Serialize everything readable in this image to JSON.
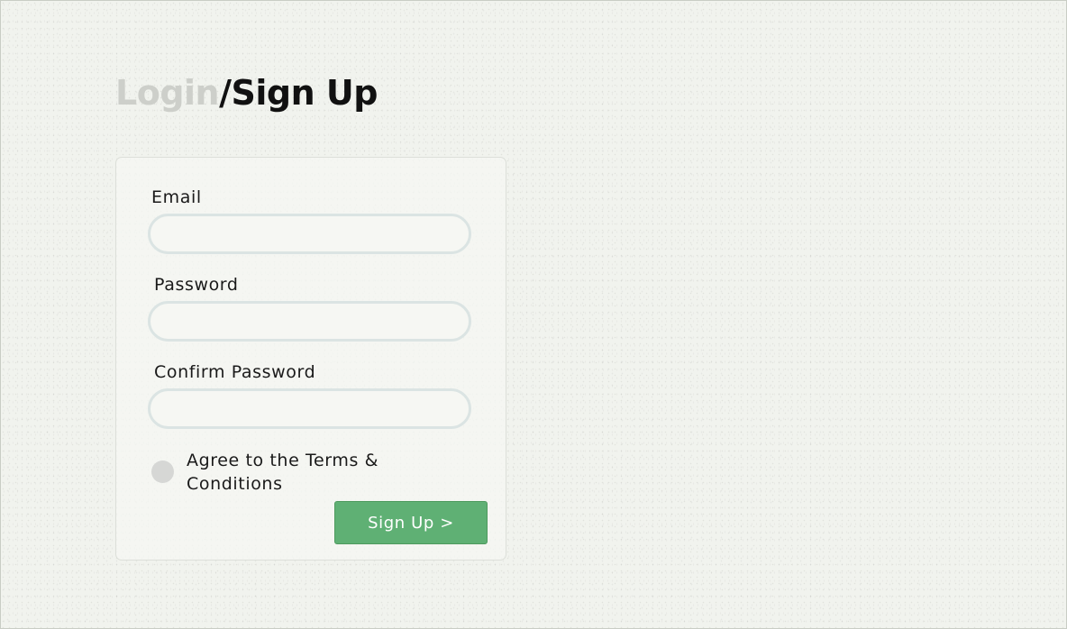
{
  "header": {
    "title_login": "Login",
    "title_separator": "/",
    "title_signup": "Sign Up"
  },
  "form": {
    "email_label": "Email",
    "email_value": "",
    "password_label": "Password",
    "password_value": "",
    "confirm_password_label": "Confirm Password",
    "confirm_password_value": "",
    "terms_label": "Agree to the Terms & Conditions",
    "terms_checked": false,
    "submit_label": "Sign Up >"
  },
  "colors": {
    "background": "#f1f3ee",
    "title_active": "#111111",
    "title_inactive": "#cdcfca",
    "input_border": "#dbe4e3",
    "button": "#5fb074",
    "checkbox": "#d6d7d5"
  }
}
